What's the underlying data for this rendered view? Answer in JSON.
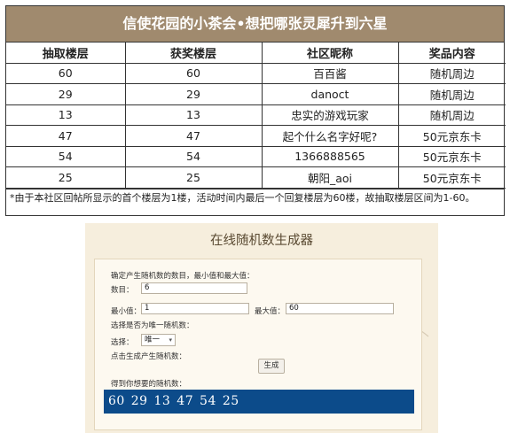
{
  "board": {
    "title": "信使花园的小茶会•想把哪张灵犀升到六星",
    "headers": [
      "抽取楼层",
      "获奖楼层",
      "社区昵称",
      "奖品内容"
    ],
    "rows": [
      [
        "60",
        "60",
        "百百酱",
        "随机周边"
      ],
      [
        "29",
        "29",
        "danoct",
        "随机周边"
      ],
      [
        "13",
        "13",
        "忠实的游戏玩家",
        "随机周边"
      ],
      [
        "47",
        "47",
        "起个什么名字好呢?",
        "50元京东卡"
      ],
      [
        "54",
        "54",
        "1366888565",
        "50元京东卡"
      ],
      [
        "25",
        "25",
        "朝阳_aoi",
        "50元京东卡"
      ]
    ],
    "note": "*由于本社区回帖所显示的首个楼层为1楼，活动时间内最后一个回复楼层为60楼，故抽取楼层区间为1-60。"
  },
  "generator": {
    "title": "在线随机数生成器",
    "instruction": "确定产生随机数的数目，最小值和最大值：",
    "count_label": "数目：",
    "count_value": "6",
    "min_label": "最小值：",
    "min_value": "1",
    "max_label": "最大值：",
    "max_value": "60",
    "unique_prompt": "选择是否为唯一随机数：",
    "select_label": "选择：",
    "select_value": "唯一",
    "click_prompt": "点击生成产生随机数：",
    "generate_label": "生成",
    "result_label": "得到你想要的随机数：",
    "result_value": "60  29  13  47  54  25"
  },
  "colors": {
    "title_bar": "#a08a6e",
    "result_bg": "#0c4b8a",
    "generator_bg": "#f6eedd"
  }
}
